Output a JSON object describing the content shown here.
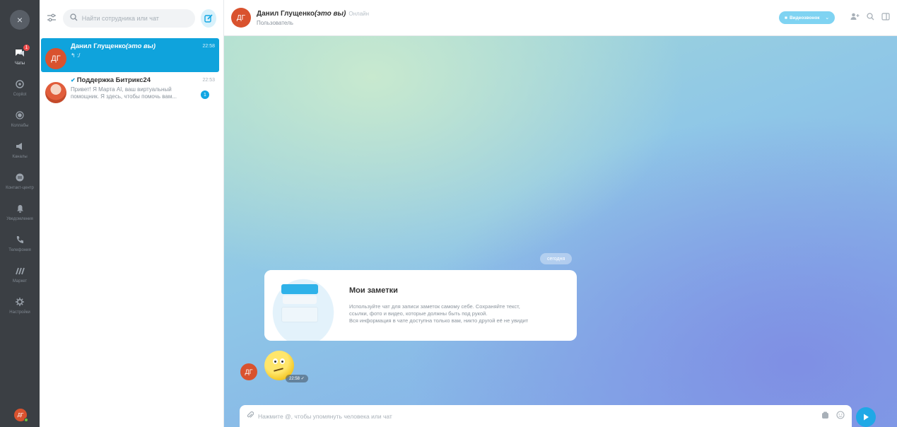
{
  "rail": {
    "close_icon": "×",
    "items": [
      {
        "label": "Чаты",
        "icon": "chat-icon",
        "active": true,
        "badge": "1"
      },
      {
        "label": "Copilot",
        "icon": "copilot-icon"
      },
      {
        "label": "Коллабы",
        "icon": "collab-icon"
      },
      {
        "label": "Каналы",
        "icon": "channels-icon"
      },
      {
        "label": "Контакт-центр",
        "icon": "contact-center-icon"
      },
      {
        "label": "Уведомления",
        "icon": "bell-icon"
      },
      {
        "label": "Телефония",
        "icon": "phone-icon"
      },
      {
        "label": "Маркет",
        "icon": "market-icon"
      },
      {
        "label": "Настройки",
        "icon": "gear-icon"
      }
    ],
    "user_initials": "ДГ"
  },
  "list": {
    "search_placeholder": "Найти сотрудника или чат",
    "chats": [
      {
        "initials": "ДГ",
        "name": "Данил Глущенко",
        "name_suffix": "(это вы)",
        "time": "22:58",
        "message": "↰ :/",
        "active": true
      },
      {
        "name": "Поддержка Битрикс24",
        "time": "22:53",
        "message": "Привет! Я Марта AI, ваш виртуальный помощник. Я здесь, чтобы помочь вам...",
        "unread": "1"
      }
    ]
  },
  "header": {
    "initials": "ДГ",
    "name": "Данил Глущенко",
    "name_suffix": "(это вы)",
    "status": "Онлайн",
    "role": "Пользователь",
    "video_label": "Видеозвонок",
    "video_dropdown": "⌄"
  },
  "chat": {
    "date_label": "сегодня",
    "notes": {
      "title": "Мои заметки",
      "text_line1": "Используйте чат для записи заметок самому себе. Сохраняйте текст,",
      "text_line2": "ссылки, фото и видео, которые должны быть под рукой.",
      "text_line3": "Вся информация в чате доступна только вам, никто другой её не увидит"
    },
    "message": {
      "sender_initials": "ДГ",
      "time": "22:58 ✓"
    },
    "composer_placeholder": "Нажмите @, чтобы упомянуть человека или чат"
  },
  "colors": {
    "accent": "#0fa3dc",
    "rail_bg": "#3b3f44",
    "avatar": "#d9522e"
  }
}
